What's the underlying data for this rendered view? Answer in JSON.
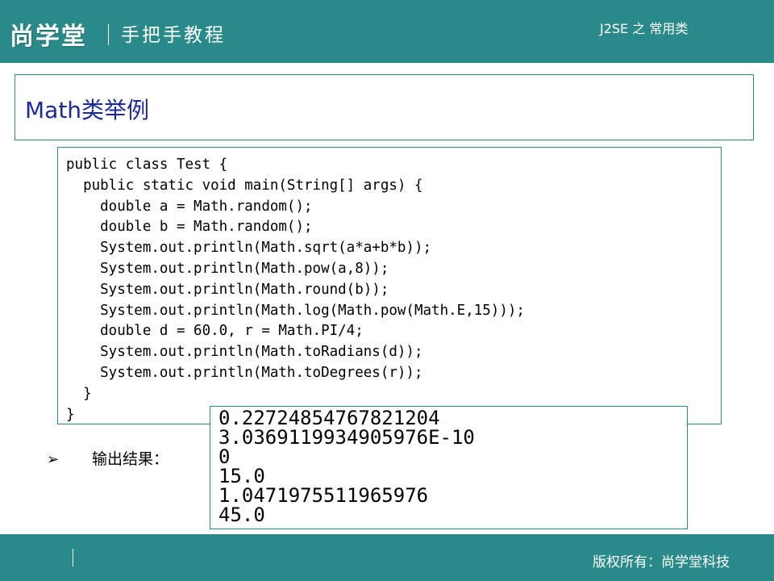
{
  "header": {
    "brand": "尚学堂",
    "subtitle": "手把手教程",
    "course": "J2SE 之 常用类"
  },
  "slide": {
    "title": "Math类举例"
  },
  "code": {
    "lines": [
      "public class Test {",
      "  public static void main(String[] args) {",
      "    double a = Math.random();",
      "    double b = Math.random();",
      "    System.out.println(Math.sqrt(a*a+b*b));",
      "    System.out.println(Math.pow(a,8));",
      "    System.out.println(Math.round(b));",
      "    System.out.println(Math.log(Math.pow(Math.E,15)));",
      "    double d = 60.0, r = Math.PI/4;",
      "    System.out.println(Math.toRadians(d));",
      "    System.out.println(Math.toDegrees(r));",
      "  }",
      "}"
    ]
  },
  "output": {
    "label": "输出结果：",
    "bullet_icon": "arrow-bullet-icon",
    "lines": [
      "0.22724854767821204",
      "3.0369119934905976E-10",
      "0",
      "15.0",
      "1.0471975511965976",
      "45.0"
    ]
  },
  "footer": {
    "copyright": "版权所有：尚学堂科技"
  },
  "colors": {
    "bar": "#2a8a8a",
    "title": "#1a2a9a"
  }
}
